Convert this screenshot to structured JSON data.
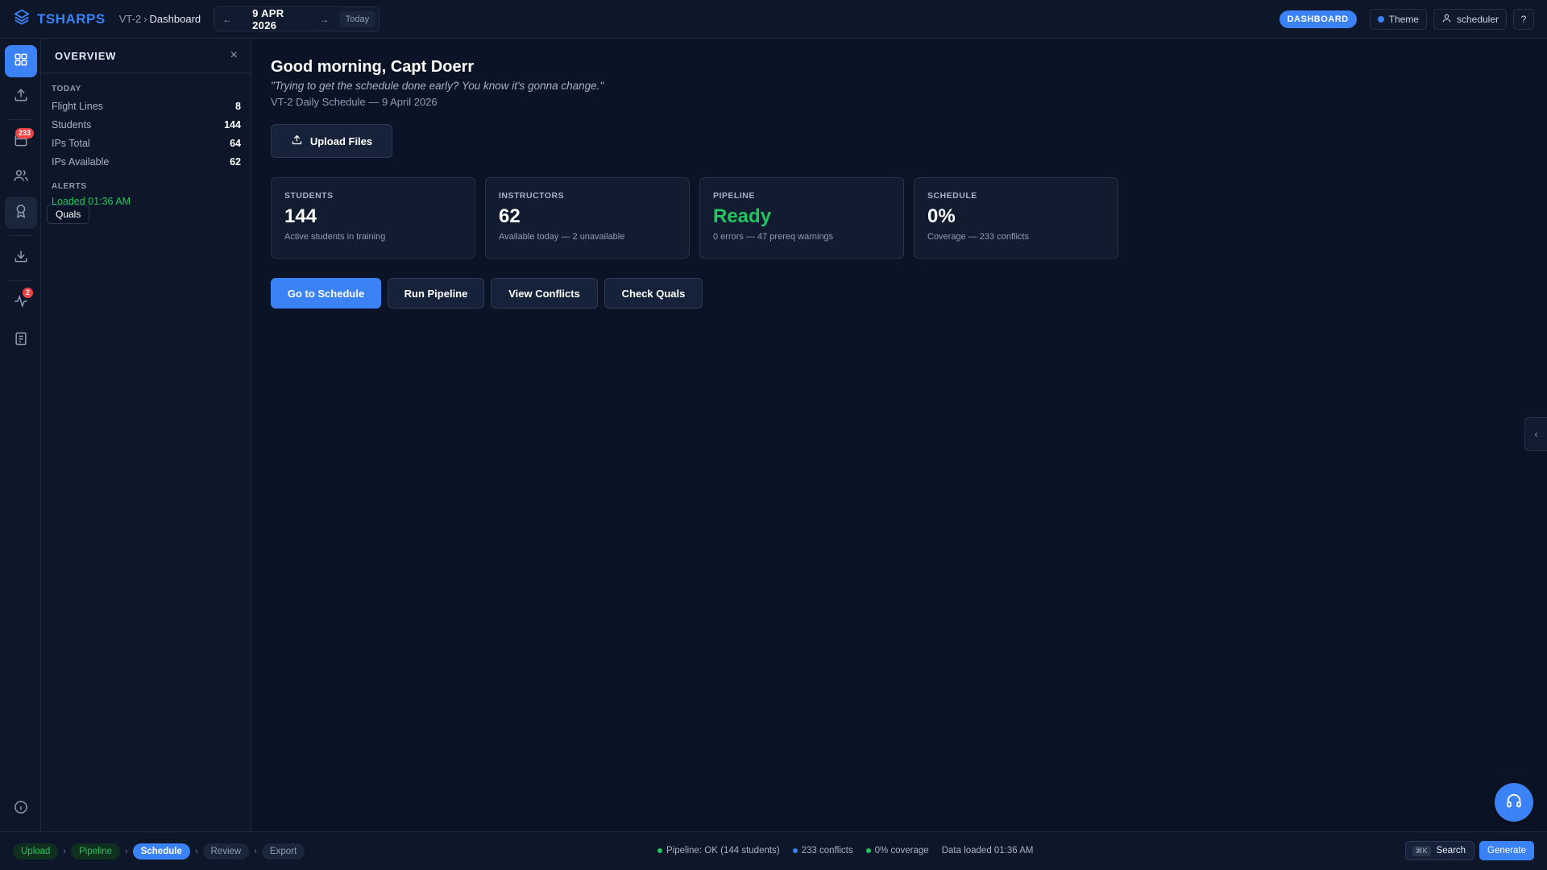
{
  "header": {
    "brand": "TSHARPS",
    "breadcrumb_root": "VT-2",
    "breadcrumb_sep": "›",
    "breadcrumb_current": "Dashboard",
    "date": "9 APR 2026",
    "prev_arrow": "←",
    "next_arrow": "→",
    "today_label": "Today",
    "mode_badge": "DASHBOARD",
    "theme_label": "Theme",
    "user_label": "scheduler",
    "help_label": "?"
  },
  "rail": {
    "badges": {
      "schedule": "233",
      "activity": "2"
    },
    "tooltip": "Quals",
    "icons": [
      "grid-icon",
      "upload-icon",
      "calendar-icon",
      "users-icon",
      "award-icon",
      "download-icon",
      "activity-icon",
      "book-icon",
      "info-icon"
    ]
  },
  "panel": {
    "title": "OVERVIEW",
    "close": "×",
    "today_label": "TODAY",
    "stats": [
      {
        "label": "Flight Lines",
        "value": "8"
      },
      {
        "label": "Students",
        "value": "144"
      },
      {
        "label": "IPs Total",
        "value": "64"
      },
      {
        "label": "IPs Available",
        "value": "62"
      }
    ],
    "alerts_label": "ALERTS",
    "alert": "Loaded 01:36 AM"
  },
  "main": {
    "greeting": "Good morning, Capt Doerr",
    "quote": "\"Trying to get the schedule done early? You know it's gonna change.\"",
    "subtitle": "VT-2 Daily Schedule — 9 April 2026",
    "upload_label": "Upload Files",
    "cards": [
      {
        "label": "STUDENTS",
        "value": "144",
        "sub": "Active students in training"
      },
      {
        "label": "INSTRUCTORS",
        "value": "62",
        "sub": "Available today — 2 unavailable"
      },
      {
        "label": "PIPELINE",
        "value": "Ready",
        "sub": "0 errors — 47 prereq warnings"
      },
      {
        "label": "SCHEDULE",
        "value": "0%",
        "sub": "Coverage — 233 conflicts"
      }
    ],
    "actions": [
      "Go to Schedule",
      "Run Pipeline",
      "View Conflicts",
      "Check Quals"
    ]
  },
  "edge_tab": "‹",
  "footer": {
    "steps": [
      "Upload",
      "Pipeline",
      "Schedule",
      "Review",
      "Export"
    ],
    "step_sep": "›",
    "status": [
      {
        "text": "Pipeline: OK (144 students)",
        "color": "#22c55e"
      },
      {
        "text": "233 conflicts",
        "color": "#3b82f6"
      },
      {
        "text": "0% coverage",
        "color": "#22c55e"
      }
    ],
    "data_loaded": "Data loaded 01:36 AM",
    "search_kbd": "⌘K",
    "search_label": "Search",
    "generate_label": "Generate"
  },
  "colors": {
    "background": "#0b1426",
    "accent": "#3b82f6",
    "success": "#22c55e",
    "danger": "#ef4444"
  }
}
